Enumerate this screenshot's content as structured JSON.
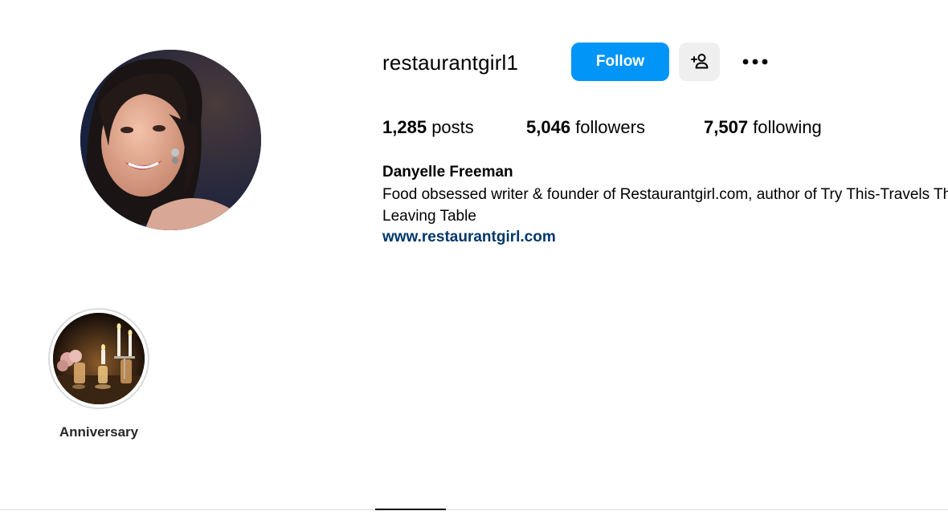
{
  "profile": {
    "username": "restaurantgirl1",
    "full_name": "Danyelle Freeman",
    "bio_lines": [
      "Food obsessed writer & founder of Restaurantgirl.com, author of Try This-Travels Through the Dishes",
      "Leaving Table"
    ],
    "website": "www.restaurantgirl.com"
  },
  "actions": {
    "follow_label": "Follow",
    "suggest_icon": "person-plus-icon",
    "more_icon": "more-horizontal-icon"
  },
  "stats": {
    "posts": {
      "count": "1,285",
      "label": "posts"
    },
    "followers": {
      "count": "5,046",
      "label": "followers"
    },
    "following": {
      "count": "7,507",
      "label": "following"
    }
  },
  "highlights": [
    {
      "label": "Anniversary"
    }
  ],
  "colors": {
    "follow_button": "#0095f6",
    "link": "#00376b",
    "secondary_button": "#efefef"
  }
}
